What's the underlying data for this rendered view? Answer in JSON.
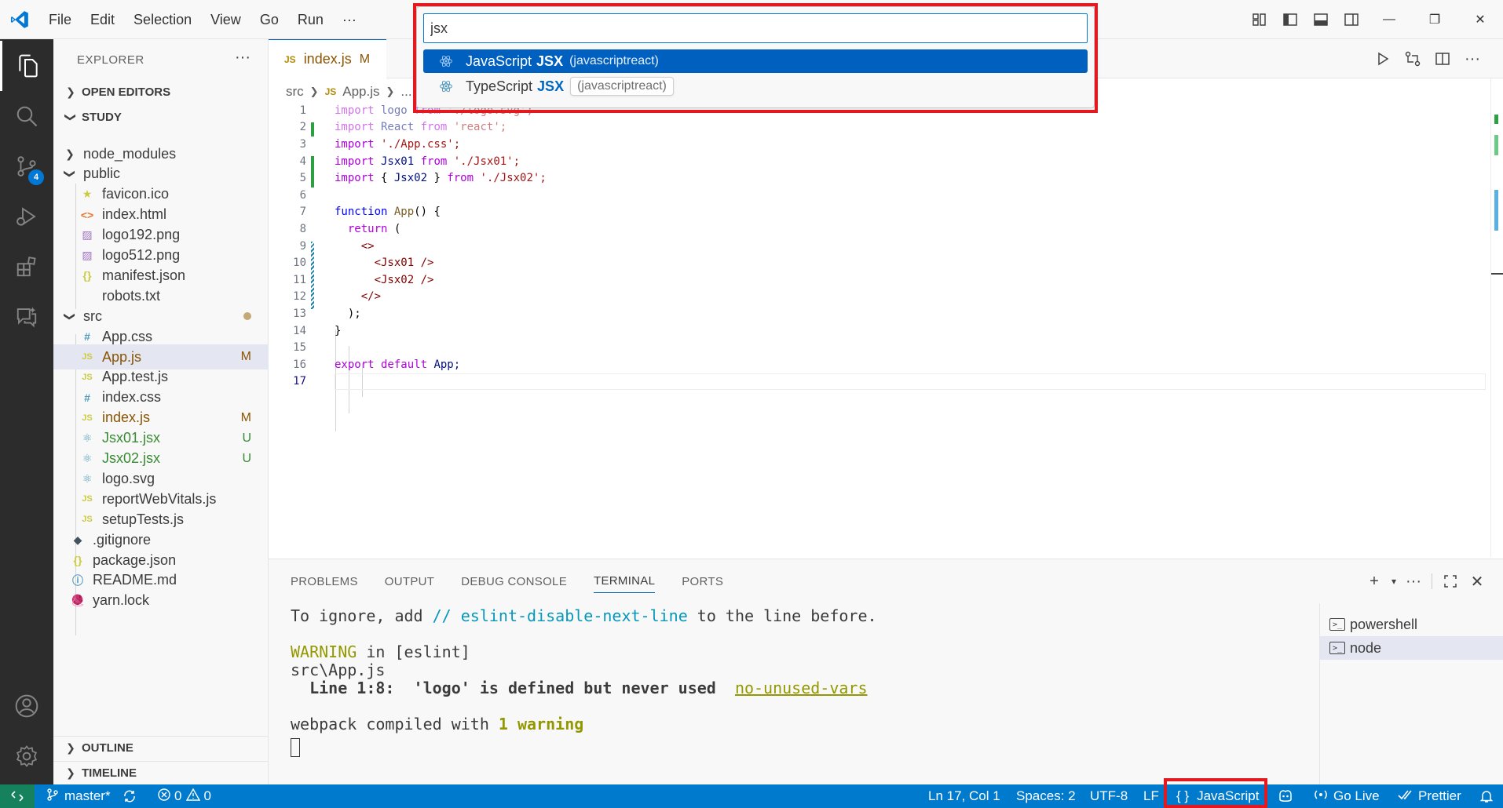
{
  "menu": [
    "File",
    "Edit",
    "Selection",
    "View",
    "Go",
    "Run",
    "···"
  ],
  "explorer": {
    "title": "EXPLORER",
    "more": "···",
    "open_editors": "OPEN EDITORS",
    "workspace": "STUDY",
    "items": [
      {
        "label": "node_modules",
        "kind": "folder",
        "status": ""
      },
      {
        "label": "public",
        "kind": "folder-open",
        "status": ""
      },
      {
        "label": "favicon.ico",
        "kind": "star",
        "status": ""
      },
      {
        "label": "index.html",
        "kind": "html",
        "status": ""
      },
      {
        "label": "logo192.png",
        "kind": "image",
        "status": ""
      },
      {
        "label": "logo512.png",
        "kind": "image",
        "status": ""
      },
      {
        "label": "manifest.json",
        "kind": "json",
        "status": ""
      },
      {
        "label": "robots.txt",
        "kind": "text",
        "status": ""
      },
      {
        "label": "src",
        "kind": "folder-open",
        "status": "dot"
      },
      {
        "label": "App.css",
        "kind": "css",
        "status": ""
      },
      {
        "label": "App.js",
        "kind": "js",
        "status": "M"
      },
      {
        "label": "App.test.js",
        "kind": "js",
        "status": ""
      },
      {
        "label": "index.css",
        "kind": "css",
        "status": ""
      },
      {
        "label": "index.js",
        "kind": "js",
        "status": "M"
      },
      {
        "label": "Jsx01.jsx",
        "kind": "react",
        "status": "U"
      },
      {
        "label": "Jsx02.jsx",
        "kind": "react",
        "status": "U"
      },
      {
        "label": "logo.svg",
        "kind": "react",
        "status": ""
      },
      {
        "label": "reportWebVitals.js",
        "kind": "js",
        "status": ""
      },
      {
        "label": "setupTests.js",
        "kind": "js",
        "status": ""
      },
      {
        "label": ".gitignore",
        "kind": "git",
        "status": ""
      },
      {
        "label": "package.json",
        "kind": "json",
        "status": ""
      },
      {
        "label": "README.md",
        "kind": "info",
        "status": ""
      },
      {
        "label": "yarn.lock",
        "kind": "yarn",
        "status": ""
      }
    ],
    "outline": "OUTLINE",
    "timeline": "TIMELINE"
  },
  "activity_badge": "4",
  "tab": {
    "icon": "JS",
    "label": "index.js",
    "status": "M"
  },
  "breadcrumb": {
    "folder": "src",
    "icon": "JS",
    "file": "App.js",
    "rest": "..."
  },
  "quickpick": {
    "query": "jsx",
    "items": [
      {
        "lang": "JavaScript",
        "match": "JSX",
        "desc": "(javascriptreact)"
      },
      {
        "lang": "TypeScript",
        "match": "JSX",
        "desc": "(javascriptreact)"
      }
    ]
  },
  "code": {
    "line_numbers": [
      "1",
      "2",
      "3",
      "4",
      "5",
      "6",
      "7",
      "8",
      "9",
      "10",
      "11",
      "12",
      "13",
      "14",
      "15",
      "16",
      "17"
    ],
    "l1a": "import",
    "l1b": " logo ",
    "l1c": "from",
    "l1d": " './logo.svg';",
    "l2a": "import",
    "l2b": " React ",
    "l2c": "from",
    "l2d": " 'react';",
    "l3a": "import",
    "l3b": " './App.css';",
    "l4a": "import",
    "l4b": " Jsx01 ",
    "l4c": "from",
    "l4d": " './Jsx01';",
    "l5a": "import",
    "l5b": " { ",
    "l5c": "Jsx02",
    "l5d": " } ",
    "l5e": "from",
    "l5f": " './Jsx02';",
    "l7a": "function",
    "l7b": " App",
    "l7c": "() {",
    "l8a": "return",
    "l8b": " (",
    "l9": "<>",
    "l10": "<Jsx01 />",
    "l11": "<Jsx02 />",
    "l12": "</>",
    "l13": ");",
    "l14": "}",
    "l16a": "export",
    "l16b": " default ",
    "l16c": "App;"
  },
  "panel": {
    "tabs": [
      "PROBLEMS",
      "OUTPUT",
      "DEBUG CONSOLE",
      "TERMINAL",
      "PORTS"
    ],
    "active_tab": "TERMINAL",
    "terminal": {
      "l1a": "To ignore, add ",
      "l1b": "// eslint-disable-next-line",
      "l1c": " to the line before.",
      "l2a": "WARNING",
      "l2b": " in [eslint]",
      "l3": "src\\App.js",
      "l4a": "  Line 1:8:  'logo' is defined but never used  ",
      "l4b": "no-unused-vars",
      "l5a": "webpack compiled with ",
      "l5b": "1",
      "l5c": " ",
      "l5d": "warning"
    },
    "terminals": [
      "powershell",
      "node"
    ]
  },
  "statusbar": {
    "branch": "master*",
    "errors": "0",
    "warnings": "0",
    "position": "Ln 17, Col 1",
    "spaces": "Spaces: 2",
    "encoding": "UTF-8",
    "eol": "LF",
    "language": "JavaScript",
    "language_icon": "{ }",
    "golive": "Go Live",
    "prettier": "Prettier"
  },
  "colors": {
    "accent": "#007acc",
    "highlight_box": "#e3191f",
    "selection": "#0060c0"
  }
}
